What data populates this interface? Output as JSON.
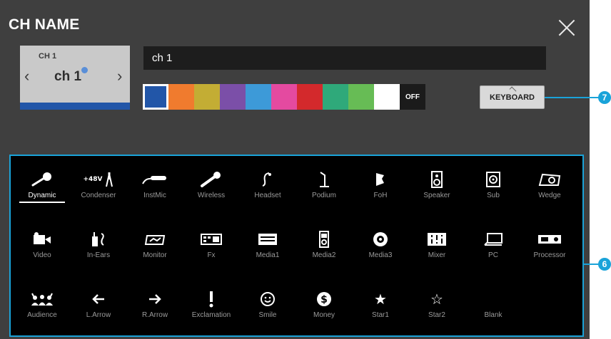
{
  "dialog": {
    "title": "CH NAME",
    "close_icon": "close-icon"
  },
  "preview": {
    "channel_number": "CH 1",
    "channel_name": "ch 1",
    "prev_icon": "chevron-left-icon",
    "next_icon": "chevron-right-icon",
    "stripe_color": "#2256a8"
  },
  "name_field": {
    "value": "ch 1"
  },
  "colors": {
    "swatches": [
      "#2256a8",
      "#f07b2e",
      "#c3ad34",
      "#7b4fa8",
      "#3d9ad8",
      "#e44aa0",
      "#d3292c",
      "#2fa97a",
      "#67bc55",
      "#ffffff"
    ],
    "selected_index": 0,
    "off_label": "OFF"
  },
  "keyboard_button": {
    "label": "KEYBOARD"
  },
  "callouts": {
    "keyboard": "7",
    "icons": "6"
  },
  "icons": {
    "selected": "Dynamic",
    "rows": [
      [
        "Dynamic",
        "Condenser",
        "InstMic",
        "Wireless",
        "Headset",
        "Podium",
        "FoH",
        "Speaker",
        "Sub",
        "Wedge"
      ],
      [
        "Video",
        "In-Ears",
        "Monitor",
        "Fx",
        "Media1",
        "Media2",
        "Media3",
        "Mixer",
        "PC",
        "Processor"
      ],
      [
        "Audience",
        "L.Arrow",
        "R.Arrow",
        "Exclamation",
        "Smile",
        "Money",
        "Star1",
        "Star2",
        "Blank"
      ]
    ],
    "condenser_badge": "+48V"
  }
}
